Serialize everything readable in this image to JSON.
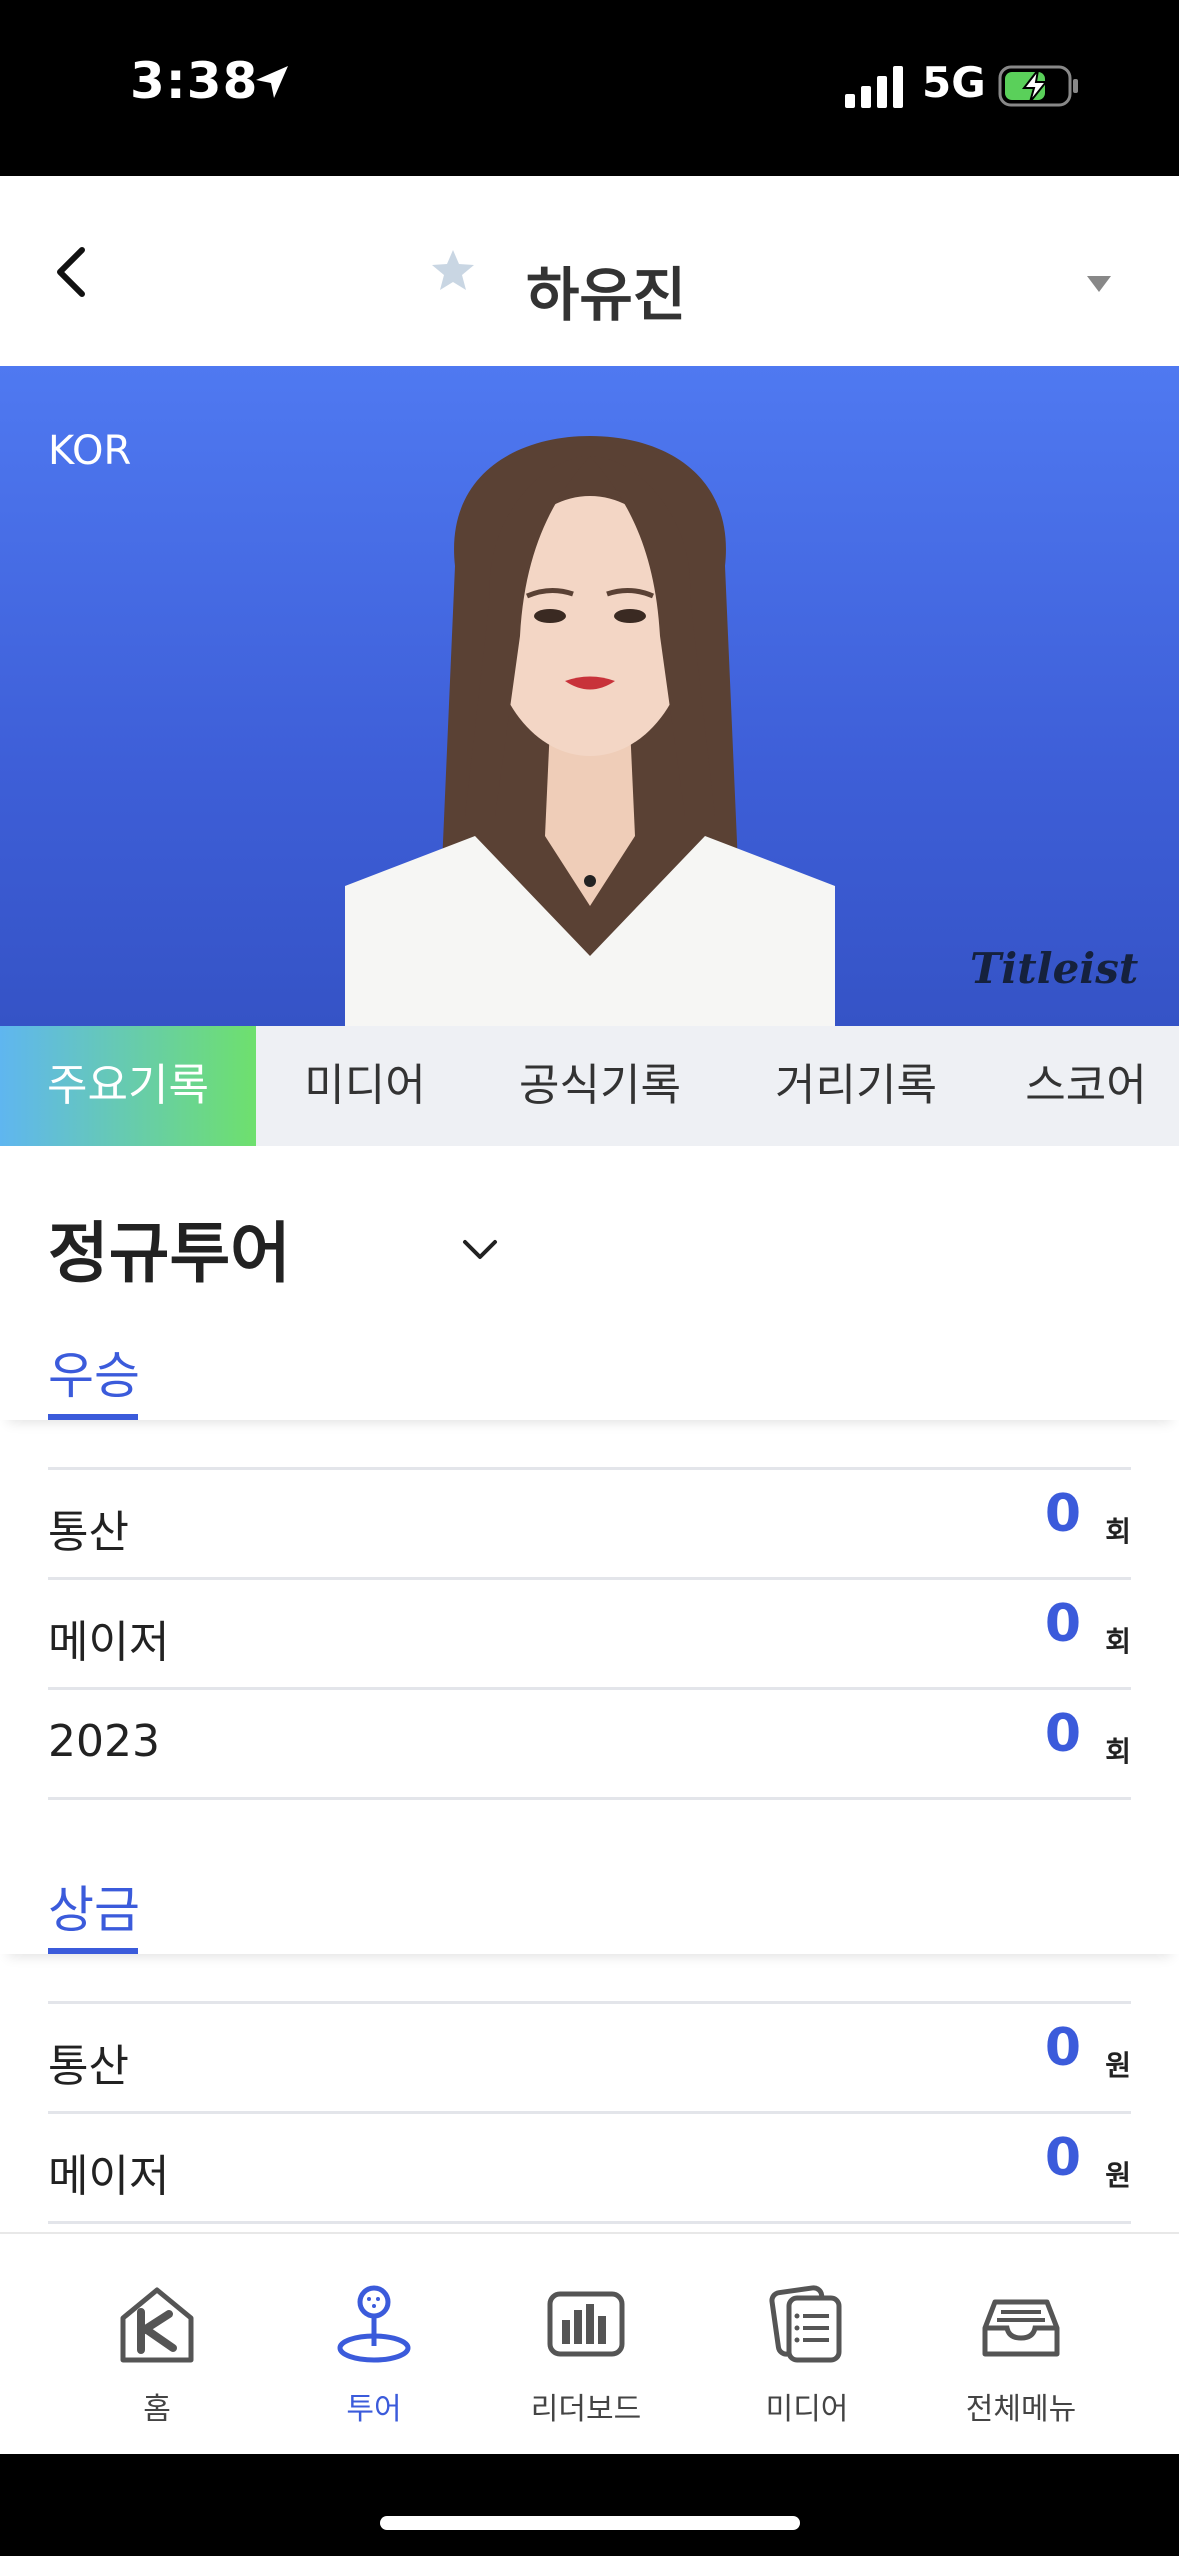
{
  "status_bar": {
    "time": "3:38",
    "network": "5G"
  },
  "header": {
    "player_name": "하유진"
  },
  "hero": {
    "country": "KOR",
    "sponsor": "Titleist",
    "background_color": "#4a6fe8"
  },
  "tabs": [
    {
      "label": "주요기록",
      "active": true
    },
    {
      "label": "미디어"
    },
    {
      "label": "공식기록"
    },
    {
      "label": "거리기록"
    },
    {
      "label": "스코어"
    }
  ],
  "tour_select": {
    "selected": "정규투어"
  },
  "wins": {
    "title": "우승",
    "rows": [
      {
        "label": "통산",
        "value": "0",
        "unit": "회"
      },
      {
        "label": "메이저",
        "value": "0",
        "unit": "회"
      },
      {
        "label": "2023",
        "value": "0",
        "unit": "회"
      }
    ]
  },
  "prize": {
    "title": "상금",
    "rows": [
      {
        "label": "통산",
        "value": "0",
        "unit": "원"
      },
      {
        "label": "메이저",
        "value": "0",
        "unit": "원"
      }
    ]
  },
  "bottom_nav": [
    {
      "label": "홈",
      "icon": "home-icon"
    },
    {
      "label": "투어",
      "icon": "golf-pin-icon",
      "active": true
    },
    {
      "label": "리더보드",
      "icon": "leaderboard-icon"
    },
    {
      "label": "미디어",
      "icon": "media-icon"
    },
    {
      "label": "전체메뉴",
      "icon": "inbox-menu-icon"
    }
  ],
  "colors": {
    "accent": "#3b5bdb",
    "tab_gradient_start": "#5fb6f0",
    "tab_gradient_end": "#6ee06d"
  }
}
